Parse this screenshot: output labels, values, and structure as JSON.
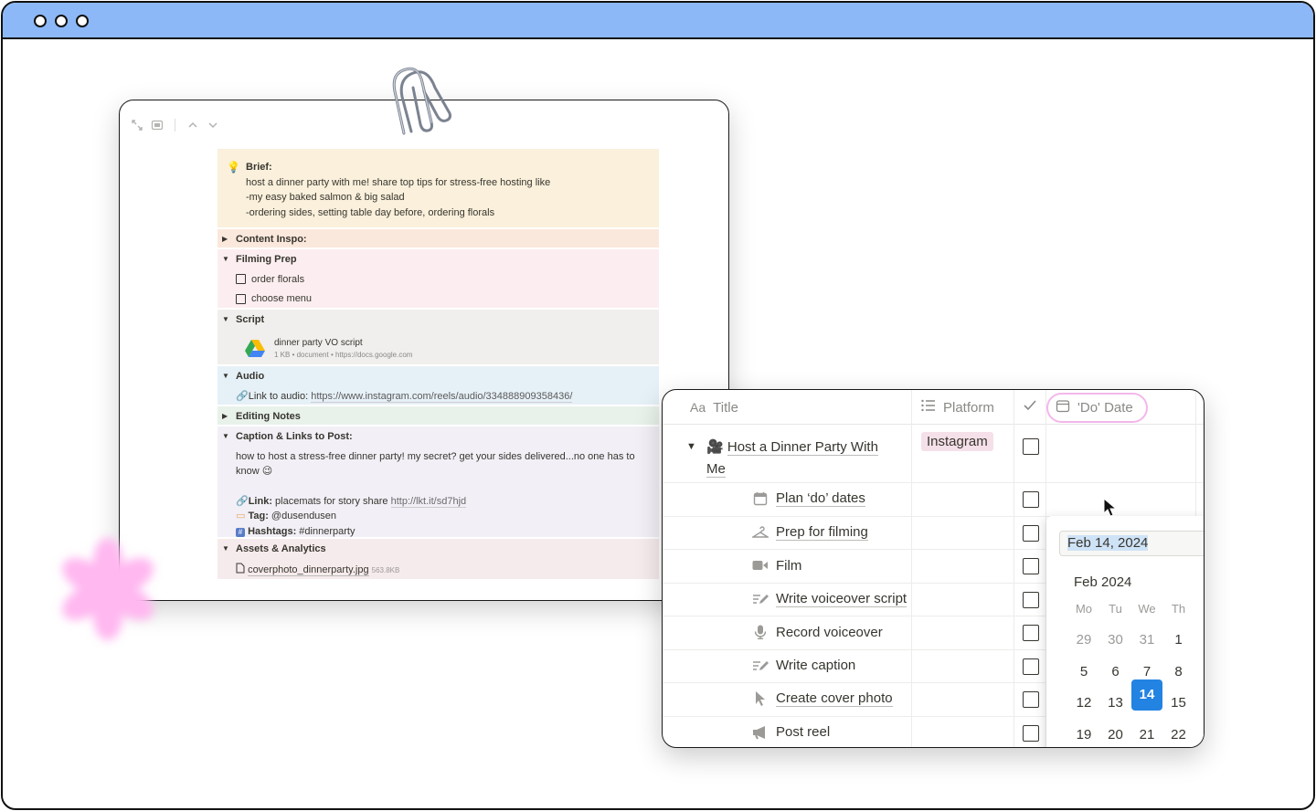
{
  "colors": {
    "browser_bar": "#8cb8f8",
    "accent_blue": "#2383e2",
    "tag_pink": "#f5e0e9",
    "flower": "#ffb8f0"
  },
  "doc": {
    "brief": {
      "title": "Brief:",
      "line1": "host a dinner party with me! share top tips for stress-free hosting like",
      "line2": "-my easy baked salmon & big salad",
      "line3": "-ordering sides, setting table day before, ordering florals"
    },
    "content_inspo": "Content Inspo:",
    "filming_prep": {
      "title": "Filming Prep",
      "todos": [
        "order florals",
        "choose menu"
      ]
    },
    "script": {
      "title": "Script",
      "file_name": "dinner party VO script",
      "file_meta": "1 KB • document • https://docs.google.com"
    },
    "audio": {
      "title": "Audio",
      "label": "Link to audio: ",
      "url": "https://www.instagram.com/reels/audio/334888909358436/"
    },
    "editing_notes": "Editing Notes",
    "caption": {
      "title": "Caption & Links to Post:",
      "text1": "how to host a stress-free dinner party! my secret? get your sides delivered...no one has to",
      "text2": "know 😉",
      "link_label": "Link:",
      "link_text": " placemats for story share ",
      "link_url": "http://lkt.it/sd7hjd",
      "tag_label": "Tag:",
      "tag_value": " @dusendusen",
      "hashtags_label": "Hashtags:",
      "hashtags_value": " #dinnerparty"
    },
    "assets": {
      "title": "Assets & Analytics",
      "file": "coverphoto_dinnerparty.jpg",
      "size": "563.8KB"
    }
  },
  "db": {
    "headers": {
      "title": "Title",
      "title_prefix": "Aa",
      "platform": "Platform",
      "do_date": "'Do' Date"
    },
    "parent": {
      "title_line1": "Host a Dinner Party With",
      "title_line2": "Me",
      "platform": "Instagram",
      "icon": "movie-camera-icon"
    },
    "subtasks": [
      {
        "title": "Plan ‘do’ dates",
        "icon": "calendar-icon"
      },
      {
        "title": "Prep for filming",
        "icon": "hanger-icon"
      },
      {
        "title": "Film",
        "icon": "video-camera-icon"
      },
      {
        "title": "Write voiceover script",
        "icon": "write-icon"
      },
      {
        "title": "Record voiceover",
        "icon": "microphone-icon"
      },
      {
        "title": "Write caption",
        "icon": "write-icon"
      },
      {
        "title": "Create cover photo",
        "icon": "cursor-icon"
      },
      {
        "title": "Post reel",
        "icon": "megaphone-icon"
      }
    ]
  },
  "picker": {
    "input_value": "Feb 14, 2024",
    "month": "Feb 2024",
    "weekdays": [
      "Mo",
      "Tu",
      "We",
      "Th"
    ],
    "week1": [
      "29",
      "30",
      "31",
      "1"
    ],
    "week2": [
      "5",
      "6",
      "7",
      "8"
    ],
    "week3": [
      "12",
      "13",
      "14",
      "15"
    ],
    "week4": [
      "19",
      "20",
      "21",
      "22"
    ],
    "selected": "14"
  }
}
